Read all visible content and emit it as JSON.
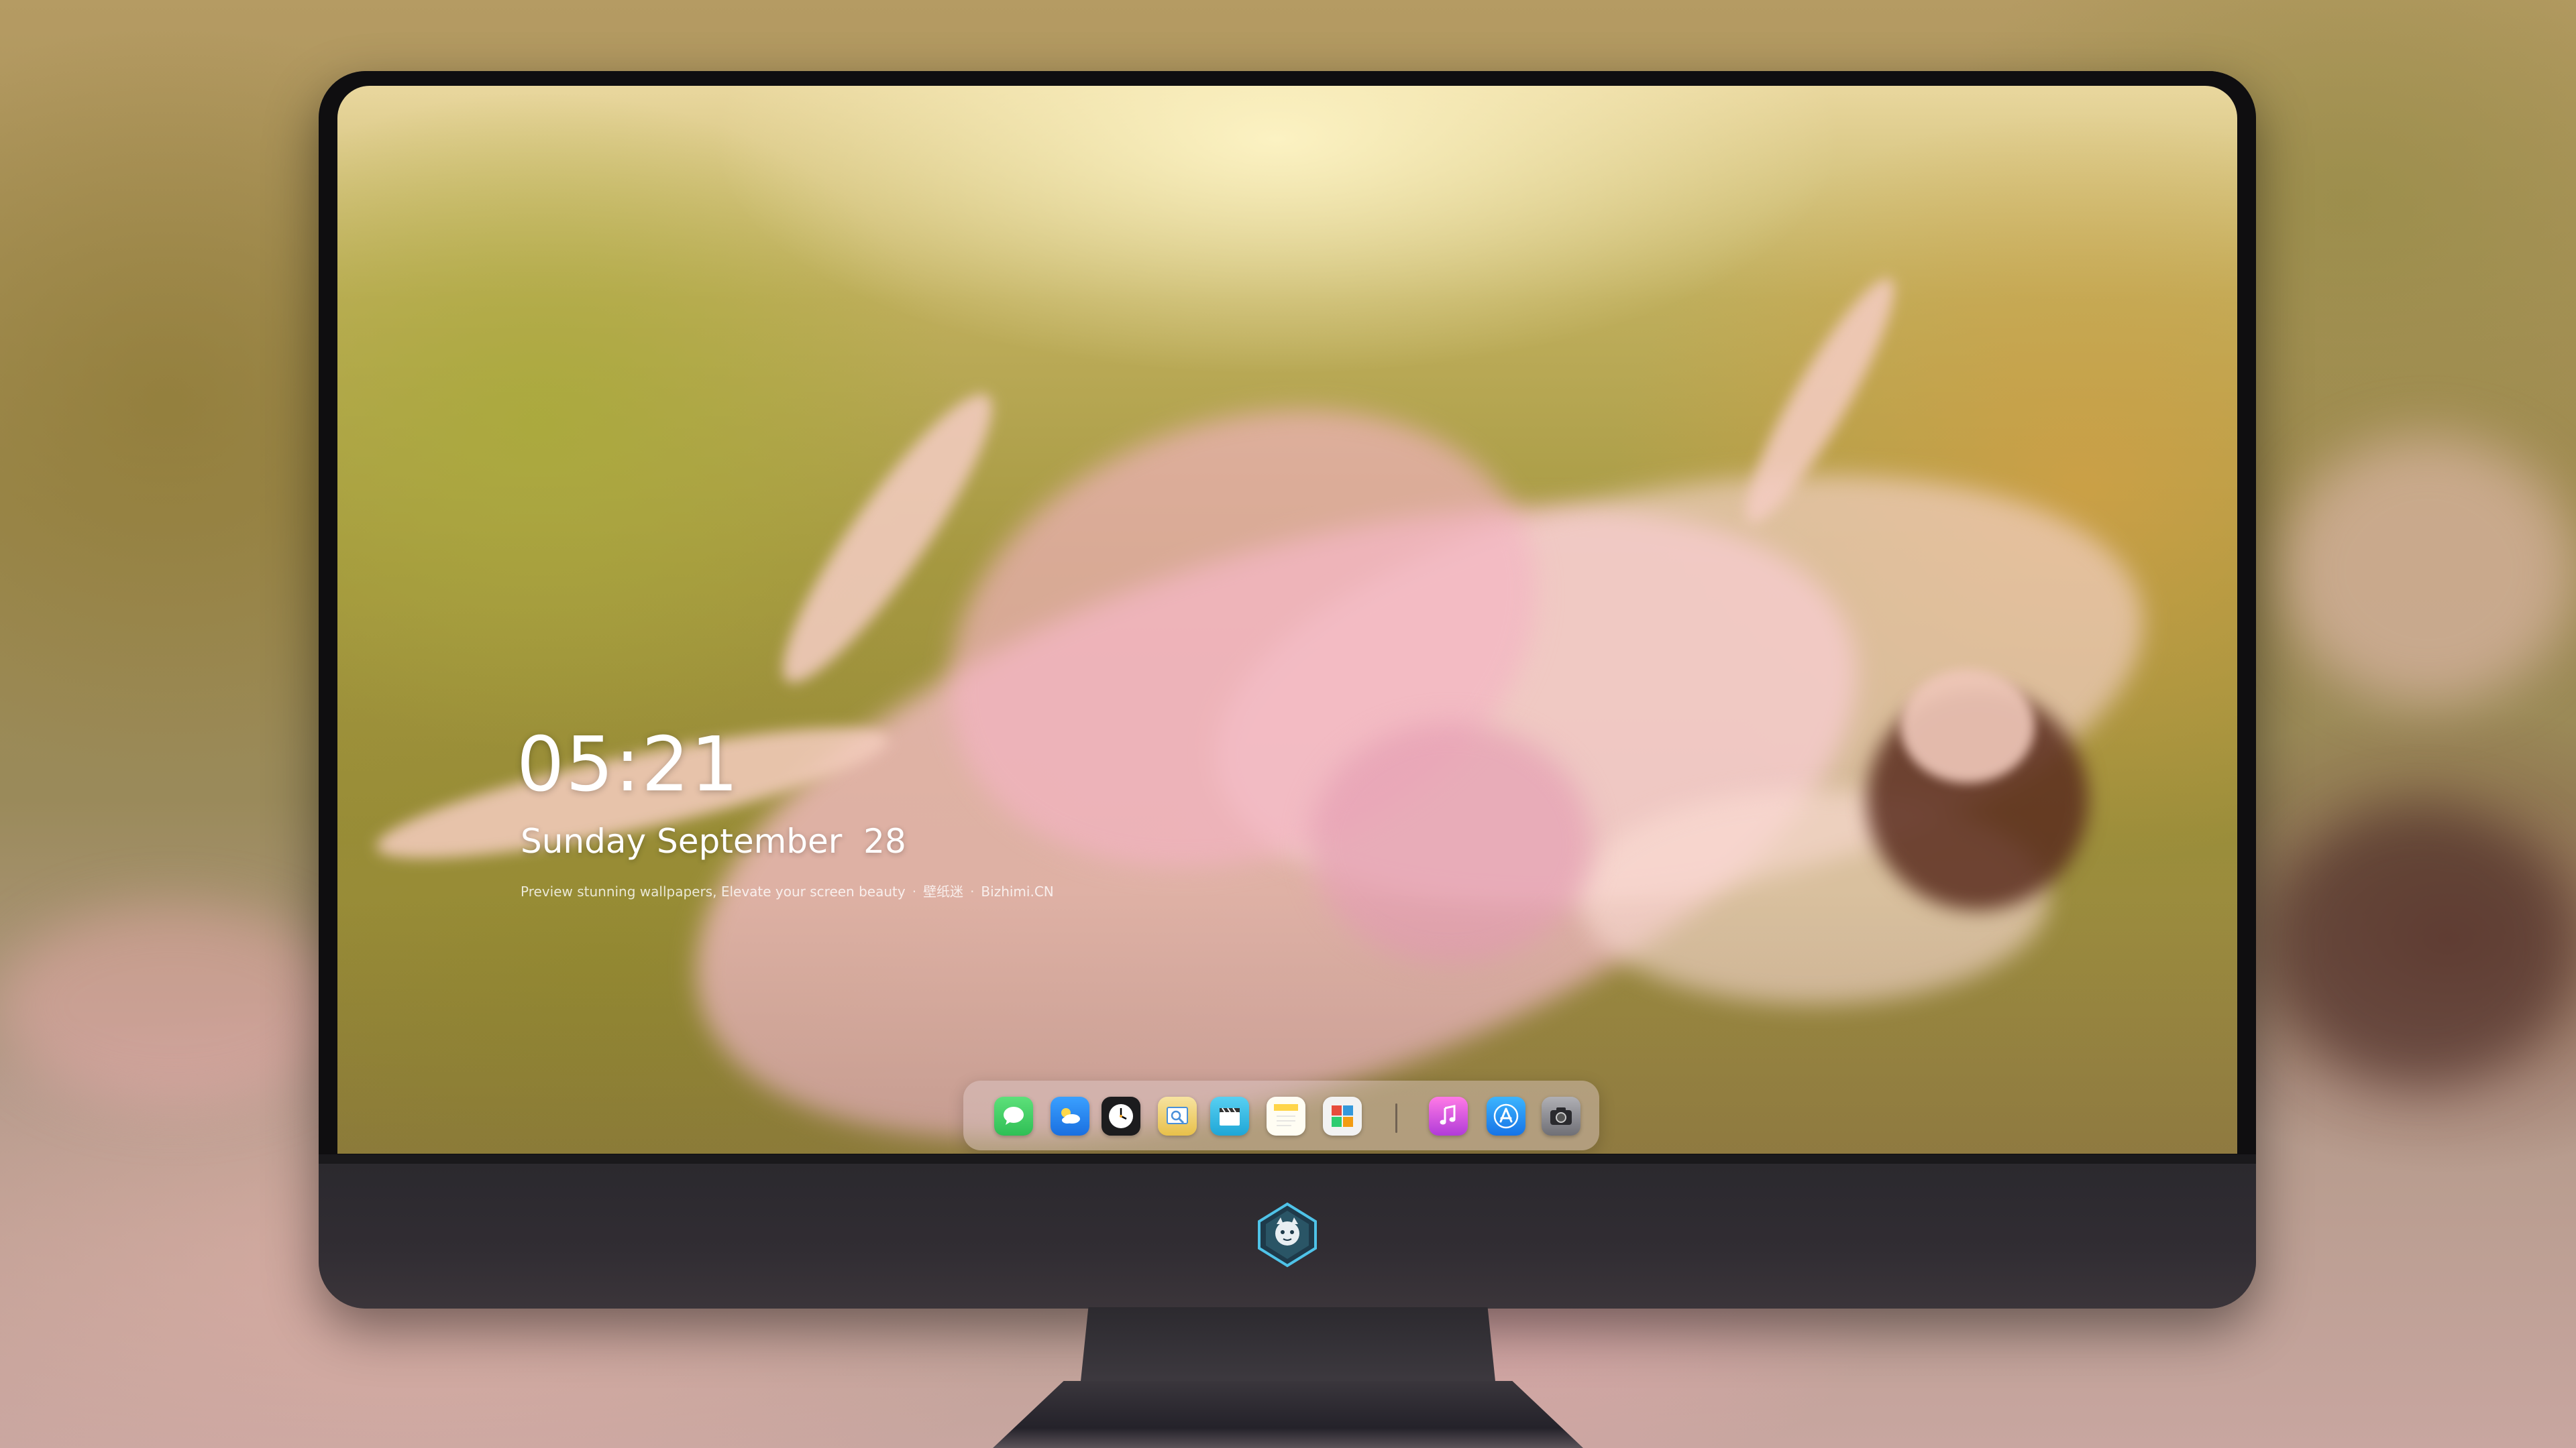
{
  "lock_screen": {
    "time": "05:21",
    "date": "Sunday September  28",
    "tagline_main": "Preview stunning wallpapers, Elevate your screen beauty",
    "tagline_cn": "壁纸迷",
    "tagline_site": "Bizhimi.CN"
  },
  "dock": {
    "apps": [
      {
        "icon": "messages-icon",
        "color": "#34c759"
      },
      {
        "icon": "weather-icon",
        "color": "#2f8cf0"
      },
      {
        "icon": "clock-icon",
        "color": "#1c1c1e"
      },
      {
        "icon": "preview-icon",
        "color": "#f2c94c"
      },
      {
        "icon": "clips-icon",
        "color": "#39b8e6"
      },
      {
        "icon": "notes-icon",
        "color": "#ffd54a"
      },
      {
        "icon": "photo-booth-icon",
        "color": "#e8e8e8"
      },
      {
        "icon": "music-icon",
        "color": "#e24bd8"
      },
      {
        "icon": "app-store-icon",
        "color": "#1e90ff"
      },
      {
        "icon": "camera-icon",
        "color": "#8e8e93"
      }
    ]
  },
  "colors": {
    "accent_dress": "#f0b4c4",
    "grass": "#a59840",
    "monitor": "#2d2b30"
  }
}
